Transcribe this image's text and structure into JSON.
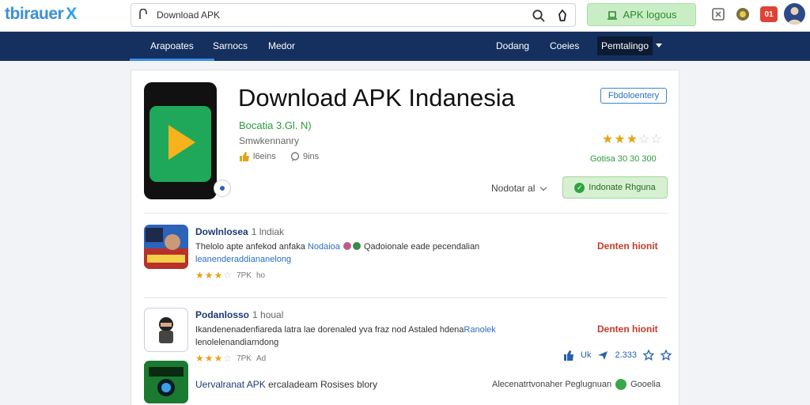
{
  "header": {
    "logo_text": "tbirauer",
    "logo_mark": "X",
    "search_value": "Download APK",
    "apk_button_label": "APK logous",
    "notification_badge": "01"
  },
  "nav": {
    "items": [
      {
        "label": "Arapoates",
        "active": true
      },
      {
        "label": "Sarnocs"
      },
      {
        "label": "Medor"
      }
    ],
    "right_items": [
      {
        "label": "Dodang"
      },
      {
        "label": "Coeies"
      }
    ],
    "dropdown_label": "Pemtalingo"
  },
  "app": {
    "title": "Download APK Indanesia",
    "version": "Bocatia 3.Gl. N)",
    "developer": "Smwkennanry",
    "meta_likes": "l6eins",
    "meta_comments": "9ins",
    "tag_button": "Fbdoloentery",
    "rating_stars": 3,
    "rating_text": "Gotisa 30 30 300",
    "sort_label": "Nodotar al",
    "install_label": "Indonate Rhguna"
  },
  "items": [
    {
      "name": "Dowlnlosea",
      "name_sub": "1 lndiak",
      "desc_part1": "Thelolo apte anfekod anfaka",
      "desc_highlight": "Nodaioa",
      "desc_part2": "Qadoionale eade pecendalian",
      "desc_line2": "leanenderaddiananelong",
      "stars": 3,
      "info_a": "7PK",
      "info_b": "ho",
      "action": "Denten hionit"
    },
    {
      "name": "Podanlosso",
      "name_sub": "1 houal",
      "desc_part1": "Ikandenenadenfiareda latra lae dorenaled yva fraz nod Astaled hdena",
      "desc_highlight": "Ranolek",
      "desc_part2": "",
      "desc_line2": "lenolelenandiarndong",
      "stars": 3,
      "info_a": "7PK",
      "info_b": "Ad",
      "action": "Denten hionit"
    }
  ],
  "social": {
    "like_label": "Uk",
    "share_count": "2.333"
  },
  "bottom_item": {
    "text_highlight": "Uervalranat APK",
    "text_rest": "ercaladeam Rosises blory",
    "right_text": "Alecenatrtvonaher Peglugnuan",
    "right_tag": "Gooelia"
  }
}
